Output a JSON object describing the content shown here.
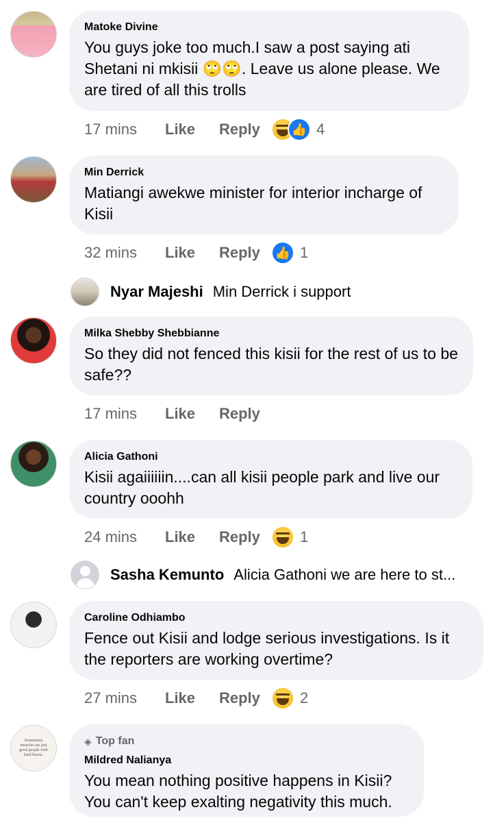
{
  "comments": [
    {
      "author": "Matoke Divine",
      "text": "You guys joke too much.I saw a post saying ati Shetani ni mkisii 🙄🙄. Leave us alone please. We are tired of all this trolls",
      "time": "17 mins",
      "like": "Like",
      "reply": "Reply",
      "reaction_count": "4"
    },
    {
      "author": "Min Derrick",
      "text": "Matiangi awekwe minister for interior incharge of Kisii",
      "time": "32 mins",
      "like": "Like",
      "reply": "Reply",
      "reaction_count": "1",
      "reply_preview": {
        "author": "Nyar Majeshi",
        "text": "Min Derrick i support"
      }
    },
    {
      "author": "Milka Shebby Shebbianne",
      "text": "So they did not fenced this kisii for the rest of us to be safe??",
      "time": "17 mins",
      "like": "Like",
      "reply": "Reply"
    },
    {
      "author": "Alicia Gathoni",
      "text": "Kisii agaiiiiiin....can all kisii people park and live our country ooohh",
      "time": "24 mins",
      "like": "Like",
      "reply": "Reply",
      "reaction_count": "1",
      "reply_preview": {
        "author": "Sasha Kemunto",
        "text": "Alicia Gathoni we are here to st..."
      }
    },
    {
      "author": "Caroline Odhiambo",
      "text": "Fence out Kisii and lodge serious investigations. Is it the reporters are working overtime?",
      "time": "27 mins",
      "like": "Like",
      "reply": "Reply",
      "reaction_count": "2"
    },
    {
      "badge": "Top fan",
      "author": "Mildred Nalianya",
      "text": "You mean nothing positive happens in Kisii? You can't keep exalting negativity this much.",
      "avatar_text": "Sometimes miracles are just good people with kind hearts."
    }
  ],
  "colors": {
    "bubble": "#f0f2f5",
    "like_blue": "#1877f2",
    "meta_gray": "#65676b",
    "haha_yellow": "#f7c83a"
  }
}
